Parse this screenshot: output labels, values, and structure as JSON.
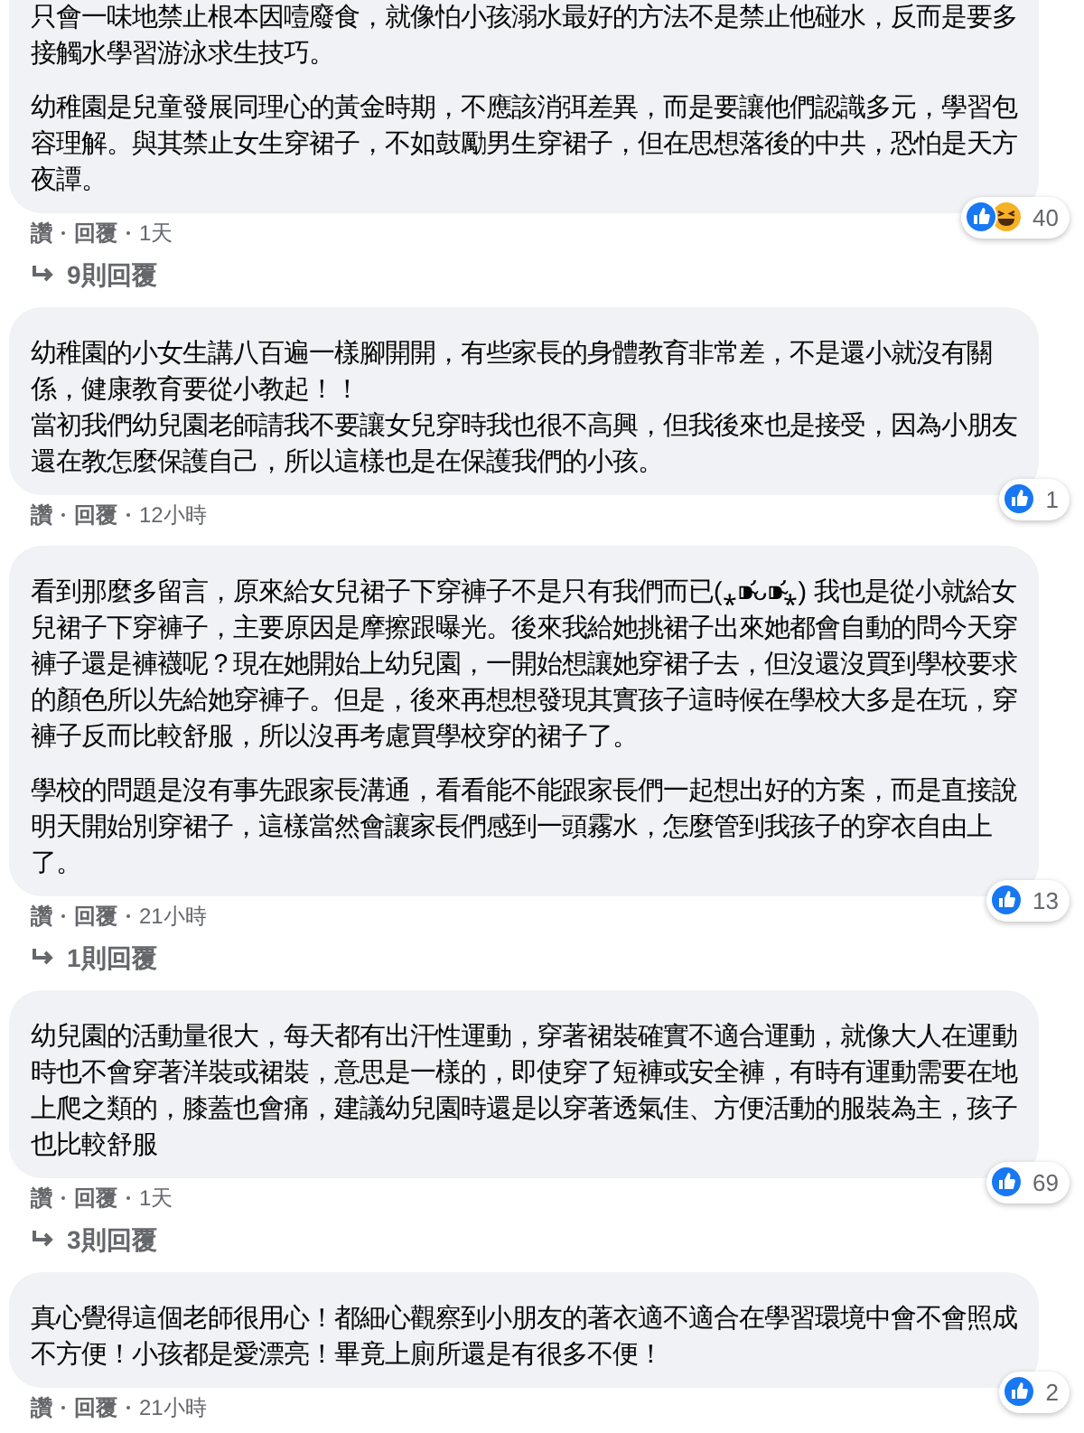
{
  "comments": [
    {
      "cut_top": true,
      "paragraphs": [
        [
          "只會一味地禁止根本因噎廢食，就像怕小孩溺水最好的方法不是禁止他碰水，反而是要多接觸水學習游泳求生技巧。"
        ],
        [
          "幼稚園是兒童發展同理心的黃金時期，不應該消弭差異，而是要讓他們認識多元，學習包容理解。與其禁止女生穿裙子，不如鼓勵男生穿裙子，但在思想落後的中共，恐怕是天方夜譚。"
        ]
      ],
      "reactions": [
        {
          "kind": "like"
        },
        {
          "kind": "haha"
        }
      ],
      "reaction_count": "40",
      "like": "讚",
      "reply": "回覆",
      "time": "1天",
      "replies": "9則回覆"
    },
    {
      "cut_top": false,
      "paragraphs": [
        [
          "幼稚園的小女生講八百遍一樣腳開開，有些家長的身體教育非常差，不是還小就沒有關係，健康教育要從小教起！！",
          "當初我們幼兒園老師請我不要讓女兒穿時我也很不高興，但我後來也是接受，因為小朋友還在教怎麼保護自己，所以這樣也是在保護我們的小孩。"
        ]
      ],
      "reactions": [
        {
          "kind": "like"
        }
      ],
      "reaction_count": "1",
      "like": "讚",
      "reply": "回覆",
      "time": "12小時"
    },
    {
      "cut_top": false,
      "paragraphs": [
        [
          "看到那麼多留言，原來給女兒裙子下穿褲子不是只有我們而已(⁎⁍̴̛ᴗ⁍̴̛⁎) 我也是從小就給女兒裙子下穿褲子，主要原因是摩擦跟曝光。後來我給她挑裙子出來她都會自動的問今天穿褲子還是褲襪呢？現在她開始上幼兒園，一開始想讓她穿裙子去，但沒還沒買到學校要求的顏色所以先給她穿褲子。但是，後來再想想發現其實孩子這時候在學校大多是在玩，穿褲子反而比較舒服，所以沒再考慮買學校穿的裙子了。"
        ],
        [
          "學校的問題是沒有事先跟家長溝通，看看能不能跟家長們一起想出好的方案，而是直接說明天開始別穿裙子，這樣當然會讓家長們感到一頭霧水，怎麼管到我孩子的穿衣自由上了。"
        ]
      ],
      "reactions": [
        {
          "kind": "like"
        }
      ],
      "reaction_count": "13",
      "like": "讚",
      "reply": "回覆",
      "time": "21小時",
      "replies": "1則回覆"
    },
    {
      "cut_top": false,
      "paragraphs": [
        [
          "幼兒園的活動量很大，每天都有出汗性運動，穿著裙裝確實不適合運動，就像大人在運動時也不會穿著洋裝或裙裝，意思是一樣的，即使穿了短褲或安全褲，有時有運動需要在地上爬之類的，膝蓋也會痛，建議幼兒園時還是以穿著透氣佳、方便活動的服裝為主，孩子也比較舒服"
        ]
      ],
      "reactions": [
        {
          "kind": "like"
        }
      ],
      "reaction_count": "69",
      "like": "讚",
      "reply": "回覆",
      "time": "1天",
      "replies": "3則回覆"
    },
    {
      "cut_top": false,
      "paragraphs": [
        [
          "真心覺得這個老師很用心！都細心觀察到小朋友的著衣適不適合在學習環境中會不會照成不方便！小孩都是愛漂亮！畢竟上廁所還是有很多不便！"
        ]
      ],
      "reactions": [
        {
          "kind": "like"
        }
      ],
      "reaction_count": "2",
      "like": "讚",
      "reply": "回覆",
      "time": "21小時"
    }
  ]
}
